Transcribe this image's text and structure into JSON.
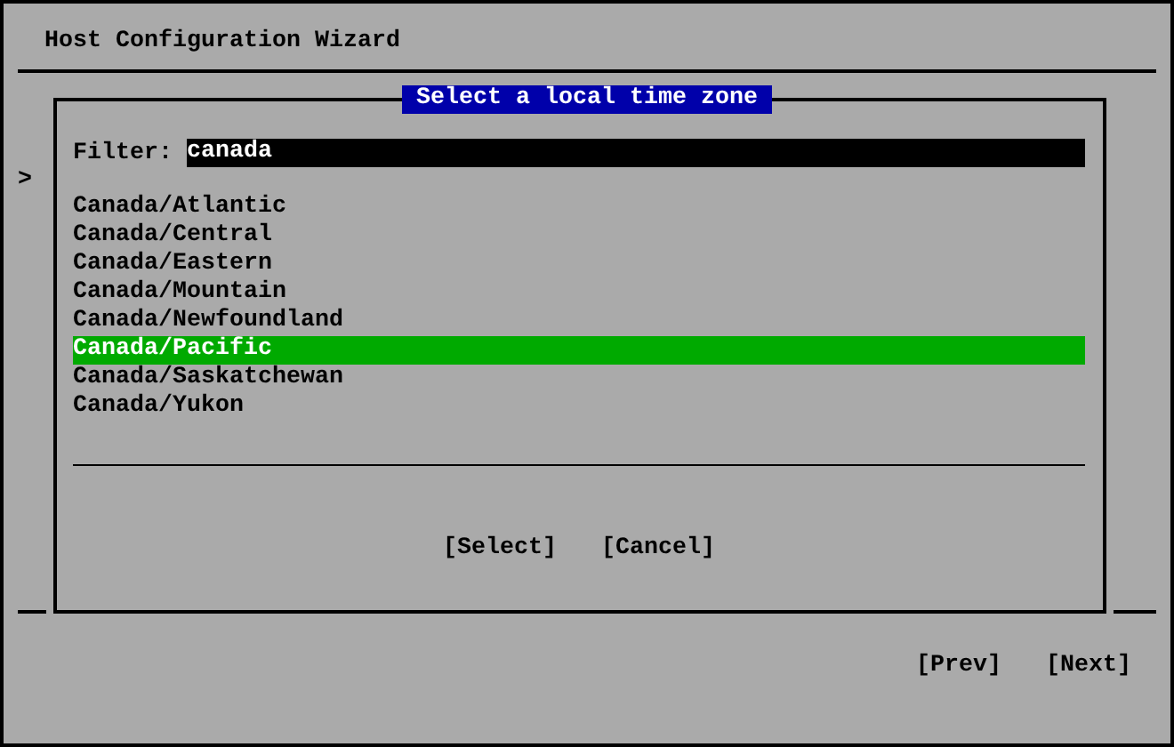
{
  "window": {
    "title": "Host Configuration Wizard"
  },
  "side_marker": ">",
  "dialog": {
    "title": "Select a local time zone",
    "filter": {
      "label": "Filter:",
      "value": "canada"
    },
    "items": [
      {
        "label": "Canada/Atlantic",
        "selected": false
      },
      {
        "label": "Canada/Central",
        "selected": false
      },
      {
        "label": "Canada/Eastern",
        "selected": false
      },
      {
        "label": "Canada/Mountain",
        "selected": false
      },
      {
        "label": "Canada/Newfoundland",
        "selected": false
      },
      {
        "label": "Canada/Pacific",
        "selected": true
      },
      {
        "label": "Canada/Saskatchewan",
        "selected": false
      },
      {
        "label": "Canada/Yukon",
        "selected": false
      }
    ],
    "buttons": [
      "[Select]",
      "[Cancel]"
    ]
  },
  "nav_buttons": [
    "[Prev]",
    "[Next]"
  ]
}
